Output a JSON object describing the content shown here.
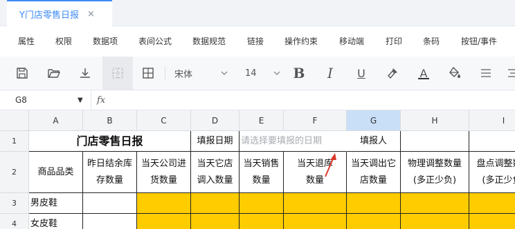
{
  "tab": {
    "title": "Y门店零售日报",
    "close": "×"
  },
  "menu": [
    "属性",
    "权限",
    "数据项",
    "表间公式",
    "数据规范",
    "链接",
    "操作约束",
    "移动端",
    "打印",
    "条码",
    "按钮/事件"
  ],
  "toolbar": {
    "font_name": "宋体",
    "font_size": "14",
    "bold": "B",
    "italic": "I",
    "underline": "U",
    "font_color_letter": "A",
    "font_color": "#333333",
    "icons": [
      "save-icon",
      "folder-open-icon",
      "download-icon",
      "no-border-icon",
      "all-borders-icon",
      "chevron-down-icon",
      "bold-icon",
      "italic-icon",
      "underline-icon",
      "format-painter-icon",
      "font-color-icon",
      "fill-color-icon",
      "align-left-icon",
      "align-center-icon"
    ]
  },
  "formula": {
    "cell_ref": "G8",
    "caret": "▼",
    "fx": "fx",
    "value": ""
  },
  "columns": [
    "A",
    "B",
    "C",
    "D",
    "E",
    "F",
    "G",
    "H",
    "I"
  ],
  "selected_column": "G",
  "rows": [
    "1",
    "2",
    "3",
    "4"
  ],
  "sheet": {
    "title": "门店零售日报",
    "report_date_label": "填报日期",
    "date_placeholder": "请选择要填报的日期",
    "reporter_label": "填报人",
    "headers": [
      "商品品类",
      "昨日结余库\n存数量",
      "当天公司进\n货数量",
      "当天它店\n调入数量",
      "当天销售\n数量",
      "当天退库\n数量",
      "当天调出它\n店数量",
      "物理调整数量\n(多正少负)",
      "盘点调整数量\n(多正少负)"
    ],
    "items": [
      "男皮鞋",
      "女皮鞋"
    ]
  },
  "colors": {
    "accent": "#3d8bf2",
    "highlight_fill": "#ffcc00",
    "selected_col": "#c9dff7",
    "arrow": "#d93a2b"
  }
}
